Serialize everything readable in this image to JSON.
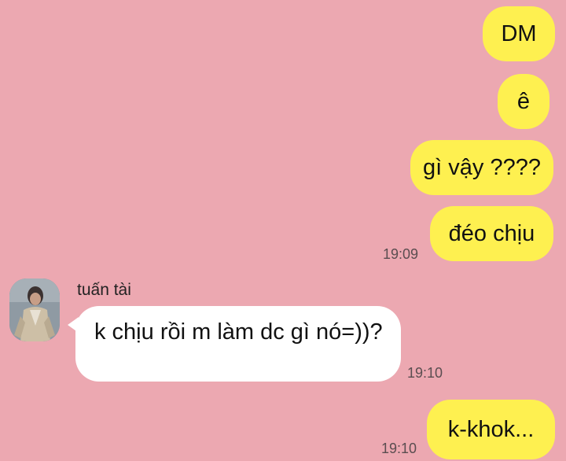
{
  "messages": [
    {
      "text": "DM"
    },
    {
      "text": "ê"
    },
    {
      "text": "gì vậy ????"
    },
    {
      "text": "đéo chịu",
      "time": "19:09"
    },
    {
      "sender": "tuấn tài",
      "text": "k chịu rồi m làm dc gì nó=))?",
      "time": "19:10"
    },
    {
      "text": "k-khok...",
      "time": "19:10"
    }
  ]
}
